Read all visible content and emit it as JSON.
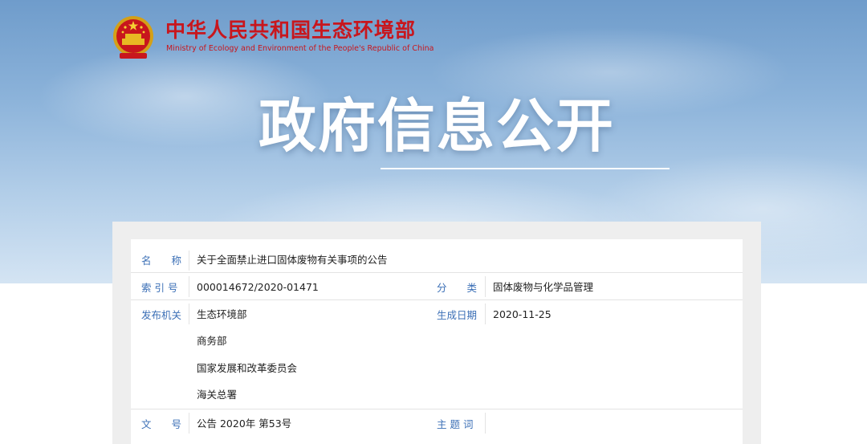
{
  "header": {
    "org_name_cn": "中华人民共和国生态环境部",
    "org_name_en": "Ministry of Ecology and Environment of the People's Republic of China",
    "page_title": "政府信息公开"
  },
  "info": {
    "name_label": "名　　称",
    "name_value": "关于全面禁止进口固体废物有关事项的公告",
    "index_label": "索 引 号",
    "index_value": "000014672/2020-01471",
    "category_label": "分　　类",
    "category_value": "固体废物与化学品管理",
    "issuer_label": "发布机关",
    "issuers": [
      "生态环境部",
      "商务部",
      "国家发展和改革委员会",
      "海关总署"
    ],
    "date_label": "生成日期",
    "date_value": "2020-11-25",
    "doc_no_label": "文　　号",
    "doc_no_value": "公告 2020年 第53号",
    "subject_label": "主 题 词",
    "subject_value": ""
  },
  "colors": {
    "brand_red": "#c8161d",
    "label_blue": "#3b6fb6"
  }
}
